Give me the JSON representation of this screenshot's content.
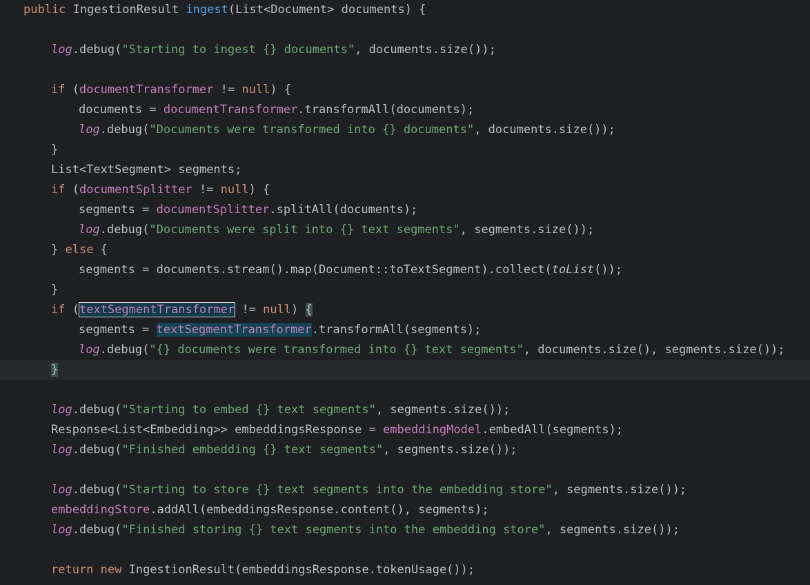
{
  "editor": {
    "colors": {
      "background": "#1e1f22",
      "keyword": "#cf8e6d",
      "method_declaration": "#56a8f5",
      "field": "#c77dbb",
      "string": "#6aab73",
      "default_text": "#bcbec4",
      "selection_highlight": "#114453"
    },
    "lines": [
      [
        [
          "kw",
          "public "
        ],
        [
          "",
          "IngestionResult "
        ],
        [
          "fn",
          "ingest"
        ],
        [
          "",
          "(List<Document> documents) {"
        ]
      ],
      [],
      [
        [
          "log",
          "log"
        ],
        [
          "",
          ".debug("
        ],
        [
          "str",
          "\"Starting to ingest {} documents\""
        ],
        [
          "",
          ", documents.size());"
        ]
      ],
      [],
      [
        [
          "kw",
          "if "
        ],
        [
          "",
          "("
        ],
        [
          "field",
          "documentTransformer"
        ],
        [
          "",
          " != "
        ],
        [
          "kw",
          "null"
        ],
        [
          "",
          ") {"
        ]
      ],
      [
        [
          "",
          "documents = "
        ],
        [
          "field",
          "documentTransformer"
        ],
        [
          "",
          ".transformAll(documents);"
        ]
      ],
      [
        [
          "log",
          "log"
        ],
        [
          "",
          ".debug("
        ],
        [
          "str",
          "\"Documents were transformed into {} documents\""
        ],
        [
          "",
          ", documents.size());"
        ]
      ],
      [
        [
          "",
          "}"
        ]
      ],
      [
        [
          "",
          "List<TextSegment> segments;"
        ]
      ],
      [
        [
          "kw",
          "if "
        ],
        [
          "",
          "("
        ],
        [
          "field",
          "documentSplitter"
        ],
        [
          "",
          " != "
        ],
        [
          "kw",
          "null"
        ],
        [
          "",
          ") {"
        ]
      ],
      [
        [
          "",
          "segments = "
        ],
        [
          "field",
          "documentSplitter"
        ],
        [
          "",
          ".splitAll(documents);"
        ]
      ],
      [
        [
          "log",
          "log"
        ],
        [
          "",
          ".debug("
        ],
        [
          "str",
          "\"Documents were split into {} text segments\""
        ],
        [
          "",
          ", segments.size());"
        ]
      ],
      [
        [
          "",
          "} "
        ],
        [
          "kw",
          "else"
        ],
        [
          "",
          " {"
        ]
      ],
      [
        [
          "",
          "segments = documents.stream().map(Document::toTextSegment).collect("
        ],
        [
          "it",
          "toList"
        ],
        [
          "",
          "());"
        ]
      ],
      [
        [
          "",
          "}"
        ]
      ],
      [
        [
          "kw",
          "if "
        ],
        [
          "",
          "("
        ],
        [
          "field sel-box",
          "textSegmentTransformer"
        ],
        [
          "",
          " != "
        ],
        [
          "kw",
          "null"
        ],
        [
          "",
          ") "
        ],
        [
          "brace-hl",
          "{"
        ]
      ],
      [
        [
          "",
          "segments = "
        ],
        [
          "field sel-hl",
          "textSegmentTransformer"
        ],
        [
          "",
          ".transformAll(segments);"
        ]
      ],
      [
        [
          "log",
          "log"
        ],
        [
          "",
          ".debug("
        ],
        [
          "str",
          "\"{} documents were transformed into {} text segments\""
        ],
        [
          "",
          ", documents.size(), segments.size());"
        ]
      ],
      [
        [
          "brace-cur",
          "}"
        ]
      ],
      [],
      [
        [
          "log",
          "log"
        ],
        [
          "",
          ".debug("
        ],
        [
          "str",
          "\"Starting to embed {} text segments\""
        ],
        [
          "",
          ", segments.size());"
        ]
      ],
      [
        [
          "",
          "Response<List<Embedding>> embeddingsResponse = "
        ],
        [
          "field",
          "embeddingModel"
        ],
        [
          "",
          ".embedAll(segments);"
        ]
      ],
      [
        [
          "log",
          "log"
        ],
        [
          "",
          ".debug("
        ],
        [
          "str",
          "\"Finished embedding {} text segments\""
        ],
        [
          "",
          ", segments.size());"
        ]
      ],
      [],
      [
        [
          "log",
          "log"
        ],
        [
          "",
          ".debug("
        ],
        [
          "str",
          "\"Starting to store {} text segments into the embedding store\""
        ],
        [
          "",
          ", segments.size());"
        ]
      ],
      [
        [
          "field",
          "embeddingStore"
        ],
        [
          "",
          ".addAll(embeddingsResponse.content(), segments);"
        ]
      ],
      [
        [
          "log",
          "log"
        ],
        [
          "",
          ".debug("
        ],
        [
          "str",
          "\"Finished storing {} text segments into the embedding store\""
        ],
        [
          "",
          ", segments.size());"
        ]
      ],
      [],
      [
        [
          "kw",
          "return "
        ],
        [
          "kw",
          "new "
        ],
        [
          "",
          "IngestionResult(embeddingsResponse.tokenUsage());"
        ]
      ]
    ]
  }
}
